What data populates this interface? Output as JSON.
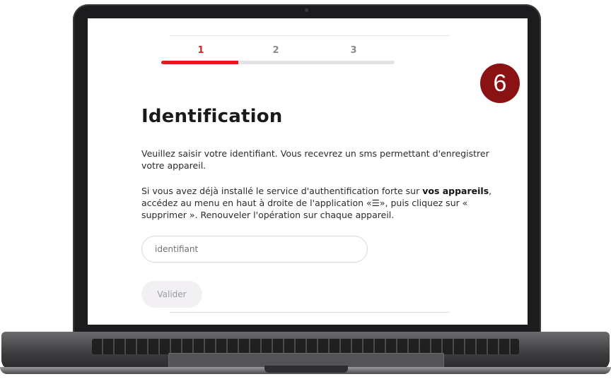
{
  "stepper": {
    "steps": [
      "1",
      "2",
      "3"
    ],
    "active_step": 1,
    "progress_fraction": 0.33
  },
  "badge": {
    "number": "6"
  },
  "page": {
    "title": "Identification",
    "paragraph1": "Veuillez saisir votre identifiant. Vous recevrez un sms permettant d'enregistrer votre appareil.",
    "paragraph2_part1": "Si vous avez déjà installé le service d'authentification forte sur ",
    "paragraph2_bold": "vos appareils",
    "paragraph2_part2": ", accédez au menu en haut à droite de l'application «☰», puis cliquez sur « supprimer ». Renouveler l'opération sur chaque appareil."
  },
  "form": {
    "identifier_placeholder": "identifiant",
    "identifier_value": "",
    "submit_label": "Valider"
  },
  "colors": {
    "accent": "#e01e1e",
    "badge": "#8b1212",
    "track": "#e4e4e8"
  }
}
